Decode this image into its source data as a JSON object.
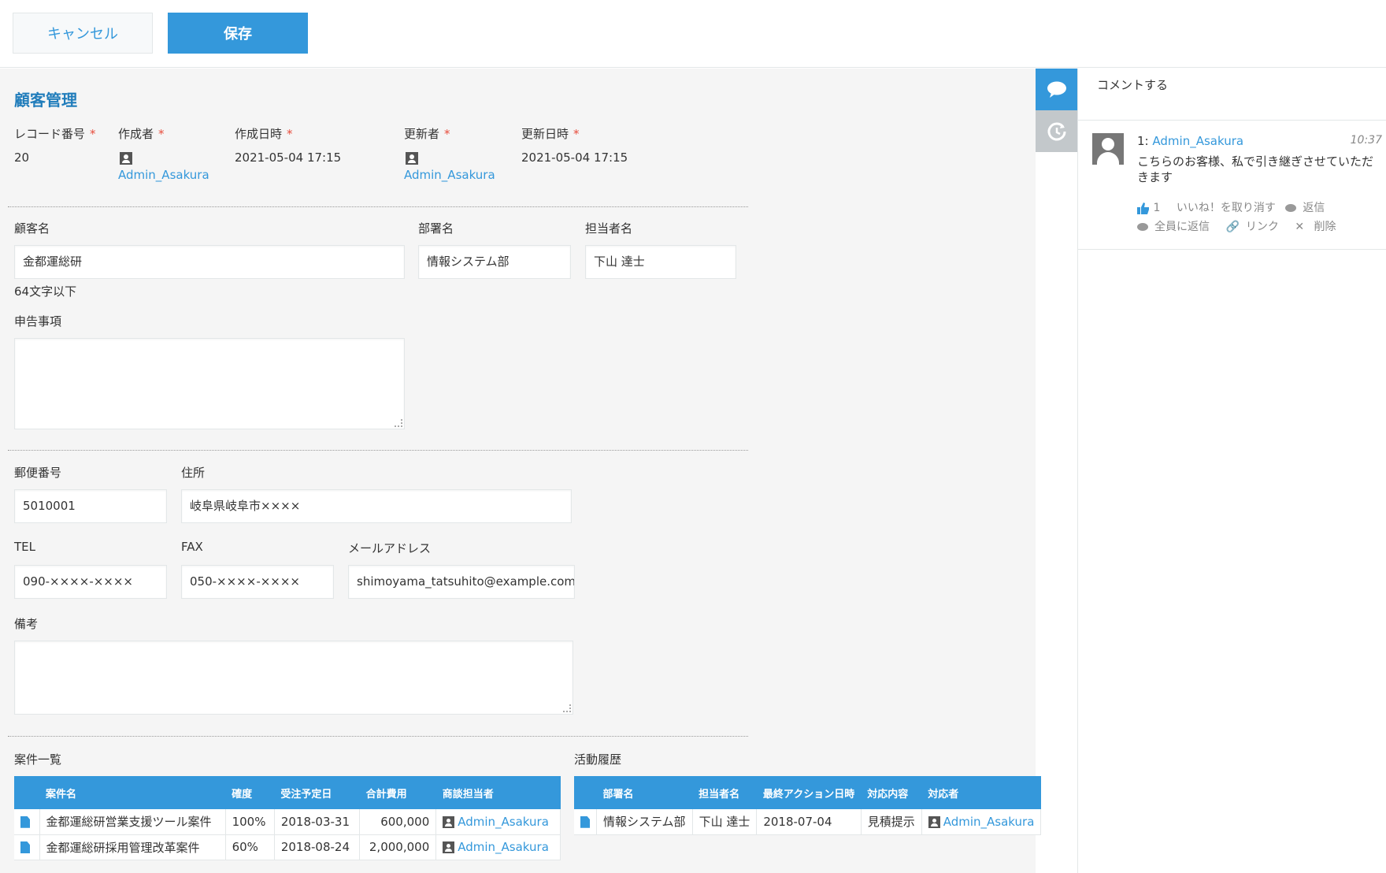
{
  "toolbar": {
    "cancel_label": "キャンセル",
    "save_label": "保存"
  },
  "app_title": "顧客管理",
  "meta": {
    "record_no_label": "レコード番号",
    "record_no": "20",
    "creator_label": "作成者",
    "creator": "Admin_Asakura",
    "created_label": "作成日時",
    "created": "2021-05-04 17:15",
    "updater_label": "更新者",
    "updater": "Admin_Asakura",
    "updated_label": "更新日時",
    "updated": "2021-05-04 17:15",
    "required_mark": "*"
  },
  "fields": {
    "customer_label": "顧客名",
    "customer": "金都運総研",
    "customer_hint": "64文字以下",
    "dept_label": "部署名",
    "dept": "情報システム部",
    "person_label": "担当者名",
    "person": "下山 達士",
    "report_label": "申告事項",
    "zip_label": "郵便番号",
    "zip": "5010001",
    "address_label": "住所",
    "address": "岐阜県岐阜市××××",
    "tel_label": "TEL",
    "tel": "090-××××-××××",
    "fax_label": "FAX",
    "fax": "050-××××-××××",
    "email_label": "メールアドレス",
    "email": "shimoyama_tatsuhito@example.com",
    "notes_label": "備考"
  },
  "deals": {
    "title": "案件一覧",
    "headers": [
      "案件名",
      "確度",
      "受注予定日",
      "合計費用",
      "商談担当者"
    ],
    "rows": [
      [
        "金都運総研営業支援ツール案件",
        "100%",
        "2018-03-31",
        "600,000",
        "Admin_Asakura"
      ],
      [
        "金都運総研採用管理改革案件",
        "60%",
        "2018-08-24",
        "2,000,000",
        "Admin_Asakura"
      ]
    ]
  },
  "activity": {
    "title": "活動履歴",
    "headers": [
      "部署名",
      "担当者名",
      "最終アクション日時",
      "対応内容",
      "対応者"
    ],
    "rows": [
      [
        "情報システム部",
        "下山 達士",
        "2018-07-04",
        "見積提示",
        "Admin_Asakura"
      ]
    ]
  },
  "comments": {
    "input_placeholder": "コメントする",
    "items": [
      {
        "index": "1:",
        "author": "Admin_Asakura",
        "time": "10:37",
        "body": "こちらのお客様、私で引き継ぎさせていただきます",
        "like_count": "1",
        "unlike_label": "いいね！を取り消す",
        "reply_label": "返信",
        "reply_all_label": "全員に返信",
        "link_label": "リンク",
        "delete_label": "削除"
      }
    ]
  },
  "colors": {
    "accent": "#3498db",
    "required": "#e74c3c",
    "background": "#f5f5f5"
  }
}
